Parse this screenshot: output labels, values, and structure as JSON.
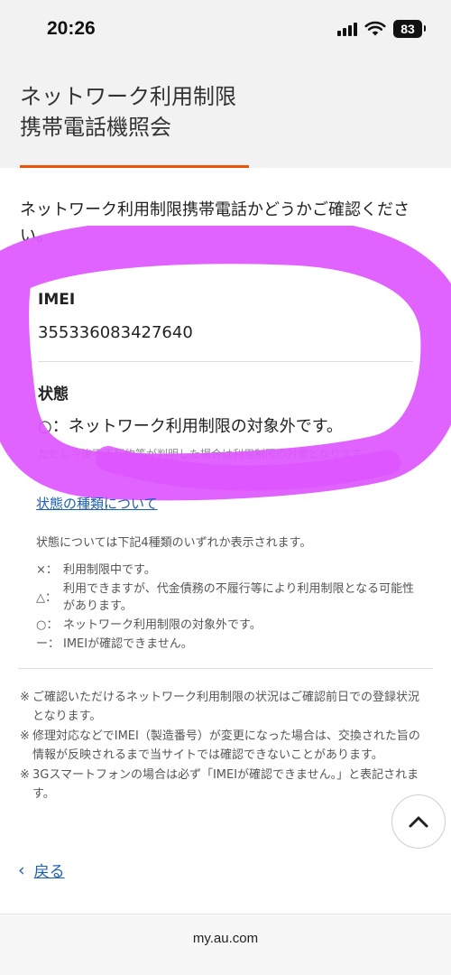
{
  "status_bar": {
    "time": "20:26",
    "icons": [
      "signal-icon",
      "wifi-icon",
      "battery-icon"
    ],
    "battery_level": "83"
  },
  "header": {
    "title": "ネットワーク利用制限\n携帯電話機照会",
    "accent_color": "#eb5505"
  },
  "intro": "ネットワーク利用制限携帯電話かどうかご確認ください。",
  "result": {
    "imei_label": "IMEI",
    "imei_value": "355336083427640",
    "status_label": "状態",
    "status_value": "○：ネットワーク利用制限の対象外です。",
    "status_note": "ただし今後不正契約等が判明した場合は利用制限の対象となります。"
  },
  "highlight_color": "#dd55ff",
  "status_types": {
    "link_label": "状態の種類について",
    "intro": "状態については下記4種類のいずれか表示されます。",
    "items": [
      {
        "symbol": "×：",
        "text": "利用制限中です。"
      },
      {
        "symbol": "△：",
        "text": "利用できますが、代金債務の不履行等により利用制限となる可能性があります。"
      },
      {
        "symbol": "○：",
        "text": "ネットワーク利用制限の対象外です。"
      },
      {
        "symbol": "ー：",
        "text": "IMEIが確認できません。"
      }
    ]
  },
  "footnotes": [
    {
      "mark": "※",
      "text": "ご確認いただけるネットワーク利用制限の状況はご確認前日での登録状況となります。"
    },
    {
      "mark": "※",
      "text": "修理対応などでIMEI（製造番号）が変更になった場合は、交換された旨の情報が反映されるまで当サイトでは確認できないことがあります。"
    },
    {
      "mark": "※",
      "text": "3Gスマートフォンの場合は必ず「IMEIが確認できません。」と表記されます。"
    }
  ],
  "scroll_top_icon": "chevron-up-icon",
  "back_link": {
    "icon": "chevron-left-icon",
    "label": "戻る"
  },
  "link_color": "#1a5fb4",
  "browser": {
    "url": "my.au.com"
  }
}
